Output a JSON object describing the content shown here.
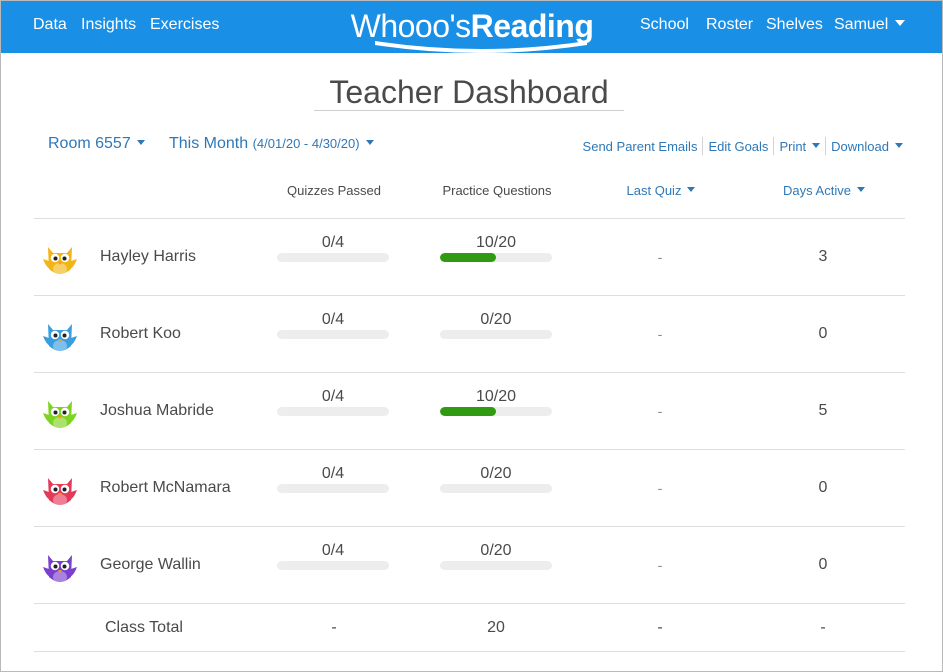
{
  "nav": {
    "left": [
      "Data",
      "Insights",
      "Exercises"
    ],
    "right": [
      "School",
      "Roster",
      "Shelves"
    ],
    "user": "Samuel"
  },
  "logo": {
    "thin": "Whooo's",
    "bold": "Reading"
  },
  "page_title": "Teacher Dashboard",
  "filters": {
    "room": "Room 6557",
    "period": "This Month",
    "range": "(4/01/20 - 4/30/20)"
  },
  "actions": [
    "Send Parent Emails",
    "Edit Goals",
    "Print",
    "Download"
  ],
  "columns": {
    "quizzes": "Quizzes Passed",
    "practice": "Practice Questions",
    "last_quiz": "Last Quiz",
    "days_active": "Days Active"
  },
  "students": [
    {
      "name": "Hayley Harris",
      "avatar": "yellow-owl-icon",
      "color": "#f2b514",
      "quizzes": "0/4",
      "quiz_pct": 0,
      "practice": "10/20",
      "practice_pct": 0.5,
      "last_quiz": "-",
      "days": "3"
    },
    {
      "name": "Robert Koo",
      "avatar": "blue-owl-icon",
      "color": "#3a9de0",
      "quizzes": "0/4",
      "quiz_pct": 0,
      "practice": "0/20",
      "practice_pct": 0,
      "last_quiz": "-",
      "days": "0"
    },
    {
      "name": "Joshua Mabride",
      "avatar": "green-owl-icon",
      "color": "#7ed321",
      "quizzes": "0/4",
      "quiz_pct": 0,
      "practice": "10/20",
      "practice_pct": 0.5,
      "last_quiz": "-",
      "days": "5"
    },
    {
      "name": "Robert McNamara",
      "avatar": "pink-owl-icon",
      "color": "#e33a5a",
      "quizzes": "0/4",
      "quiz_pct": 0,
      "practice": "0/20",
      "practice_pct": 0,
      "last_quiz": "-",
      "days": "0"
    },
    {
      "name": "George Wallin",
      "avatar": "purple-owl-icon",
      "color": "#7b3fd0",
      "quizzes": "0/4",
      "quiz_pct": 0,
      "practice": "0/20",
      "practice_pct": 0,
      "last_quiz": "-",
      "days": "0"
    }
  ],
  "total": {
    "label": "Class Total",
    "quizzes": "-",
    "practice": "20",
    "last_quiz": "-",
    "days": "-"
  },
  "colors": {
    "topbar": "#1a8fe6",
    "link": "#2f78b7",
    "progress": "#2f9a12"
  }
}
